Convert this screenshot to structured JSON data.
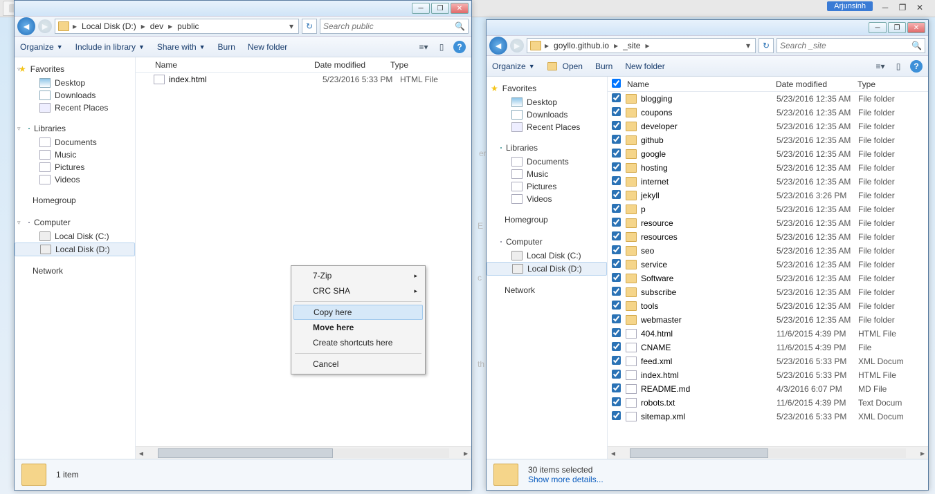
{
  "topbar": {
    "user": "Arjunsinh"
  },
  "win1": {
    "title_min": "_",
    "title_max": "❐",
    "title_close": "✕",
    "breadcrumb": [
      "Local Disk (D:)",
      "dev",
      "public"
    ],
    "search_placeholder": "Search public",
    "toolbar": {
      "organize": "Organize",
      "include": "Include in library",
      "share": "Share with",
      "burn": "Burn",
      "newfolder": "New folder"
    },
    "nav": {
      "favorites": "Favorites",
      "desktop": "Desktop",
      "downloads": "Downloads",
      "recent": "Recent Places",
      "libraries": "Libraries",
      "documents": "Documents",
      "music": "Music",
      "pictures": "Pictures",
      "videos": "Videos",
      "homegroup": "Homegroup",
      "computer": "Computer",
      "diskc": "Local Disk (C:)",
      "diskd": "Local Disk (D:)",
      "network": "Network"
    },
    "cols": {
      "name": "Name",
      "date": "Date modified",
      "type": "Type"
    },
    "files": [
      {
        "name": "index.html",
        "date": "5/23/2016 5:33 PM",
        "type": "HTML File",
        "icon": "html"
      }
    ],
    "status": {
      "count": "1 item"
    },
    "context": {
      "sevenzip": "7-Zip",
      "crcsha": "CRC SHA",
      "copy": "Copy here",
      "move": "Move here",
      "shortcuts": "Create shortcuts here",
      "cancel": "Cancel"
    }
  },
  "win2": {
    "breadcrumb": [
      "goyllo.github.io",
      "_site"
    ],
    "search_placeholder": "Search _site",
    "toolbar": {
      "organize": "Organize",
      "open": "Open",
      "burn": "Burn",
      "newfolder": "New folder"
    },
    "nav": {
      "favorites": "Favorites",
      "desktop": "Desktop",
      "downloads": "Downloads",
      "recent": "Recent Places",
      "libraries": "Libraries",
      "documents": "Documents",
      "music": "Music",
      "pictures": "Pictures",
      "videos": "Videos",
      "homegroup": "Homegroup",
      "computer": "Computer",
      "diskc": "Local Disk (C:)",
      "diskd": "Local Disk (D:)",
      "network": "Network"
    },
    "cols": {
      "name": "Name",
      "date": "Date modified",
      "type": "Type"
    },
    "files": [
      {
        "name": "blogging",
        "date": "5/23/2016 12:35 AM",
        "type": "File folder",
        "icon": "folder"
      },
      {
        "name": "coupons",
        "date": "5/23/2016 12:35 AM",
        "type": "File folder",
        "icon": "folder"
      },
      {
        "name": "developer",
        "date": "5/23/2016 12:35 AM",
        "type": "File folder",
        "icon": "folder"
      },
      {
        "name": "github",
        "date": "5/23/2016 12:35 AM",
        "type": "File folder",
        "icon": "folder"
      },
      {
        "name": "google",
        "date": "5/23/2016 12:35 AM",
        "type": "File folder",
        "icon": "folder"
      },
      {
        "name": "hosting",
        "date": "5/23/2016 12:35 AM",
        "type": "File folder",
        "icon": "folder"
      },
      {
        "name": "internet",
        "date": "5/23/2016 12:35 AM",
        "type": "File folder",
        "icon": "folder"
      },
      {
        "name": "jekyll",
        "date": "5/23/2016 3:26 PM",
        "type": "File folder",
        "icon": "folder"
      },
      {
        "name": "p",
        "date": "5/23/2016 12:35 AM",
        "type": "File folder",
        "icon": "folder"
      },
      {
        "name": "resource",
        "date": "5/23/2016 12:35 AM",
        "type": "File folder",
        "icon": "folder"
      },
      {
        "name": "resources",
        "date": "5/23/2016 12:35 AM",
        "type": "File folder",
        "icon": "folder"
      },
      {
        "name": "seo",
        "date": "5/23/2016 12:35 AM",
        "type": "File folder",
        "icon": "folder"
      },
      {
        "name": "service",
        "date": "5/23/2016 12:35 AM",
        "type": "File folder",
        "icon": "folder"
      },
      {
        "name": "Software",
        "date": "5/23/2016 12:35 AM",
        "type": "File folder",
        "icon": "folder"
      },
      {
        "name": "subscribe",
        "date": "5/23/2016 12:35 AM",
        "type": "File folder",
        "icon": "folder"
      },
      {
        "name": "tools",
        "date": "5/23/2016 12:35 AM",
        "type": "File folder",
        "icon": "folder"
      },
      {
        "name": "webmaster",
        "date": "5/23/2016 12:35 AM",
        "type": "File folder",
        "icon": "folder"
      },
      {
        "name": "404.html",
        "date": "11/6/2015 4:39 PM",
        "type": "HTML File",
        "icon": "html"
      },
      {
        "name": "CNAME",
        "date": "11/6/2015 4:39 PM",
        "type": "File",
        "icon": "file"
      },
      {
        "name": "feed.xml",
        "date": "5/23/2016 5:33 PM",
        "type": "XML Docum",
        "icon": "file"
      },
      {
        "name": "index.html",
        "date": "5/23/2016 5:33 PM",
        "type": "HTML File",
        "icon": "html"
      },
      {
        "name": "README.md",
        "date": "4/3/2016 6:07 PM",
        "type": "MD File",
        "icon": "file"
      },
      {
        "name": "robots.txt",
        "date": "11/6/2015 4:39 PM",
        "type": "Text Docum",
        "icon": "file"
      },
      {
        "name": "sitemap.xml",
        "date": "5/23/2016 5:33 PM",
        "type": "XML Docum",
        "icon": "file"
      }
    ],
    "status": {
      "count": "30 items selected",
      "more": "Show more details..."
    }
  }
}
